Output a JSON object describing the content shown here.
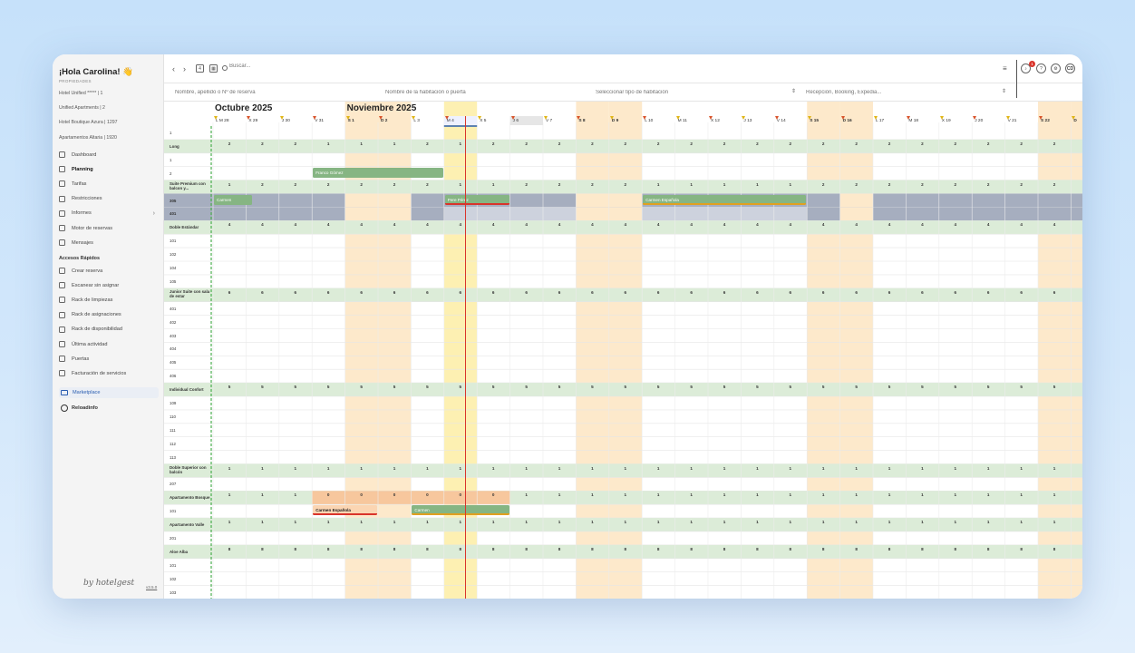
{
  "sidebar": {
    "greeting": "¡Hola Carolina! 👋",
    "properties_label": "PROPIEDADES",
    "properties": [
      "Hotel Unified ***** | 1",
      "Unified Apartments | 2",
      "Hotel Boutique Azura | 1297",
      "Apartamentos Altaria | 1920"
    ],
    "nav": [
      {
        "label": "Dashboard",
        "icon": "dashboard-icon"
      },
      {
        "label": "Planning",
        "icon": "calendar-icon",
        "active": true
      },
      {
        "label": "Tarifas",
        "icon": "rates-chart-icon"
      },
      {
        "label": "Restricciones",
        "icon": "restrictions-icon"
      },
      {
        "label": "Informes",
        "icon": "reports-icon",
        "chevron": true
      },
      {
        "label": "Motor de reservas",
        "icon": "booking-engine-icon"
      },
      {
        "label": "Mensajes",
        "icon": "messages-icon"
      }
    ],
    "quick_access_label": "Accesos Rápidos",
    "quick": [
      {
        "label": "Crear reserva",
        "icon": "plus-circle-icon"
      },
      {
        "label": "Escanear sin asignar",
        "icon": "scan-icon"
      },
      {
        "label": "Rack de limpiezas",
        "icon": "cleaning-icon"
      },
      {
        "label": "Rack de asignaciones",
        "icon": "assign-icon"
      },
      {
        "label": "Rack de disponibilidad",
        "icon": "availability-icon"
      },
      {
        "label": "Última actividad",
        "icon": "activity-icon"
      },
      {
        "label": "Puertas",
        "icon": "key-icon"
      },
      {
        "label": "Facturación de servicios",
        "icon": "invoice-icon"
      }
    ],
    "marketplace": "Marketplace",
    "reload": "Reloadinfo",
    "brand": "by hotelgest",
    "version": "v3.5.0"
  },
  "topbar": {
    "search_placeholder": "Buscar...",
    "initials": "CD",
    "notif_count": "1"
  },
  "filters": {
    "guest_placeholder": "Nombre, apellido o Nº de reserva",
    "room_placeholder": "Nombre de la habitación o puerta",
    "room_type_placeholder": "Seleccionar tipo de habitación",
    "channel_placeholder": "Recepción, Booking, Expedia..."
  },
  "calendar": {
    "months": [
      {
        "label": "Octubre 2025",
        "day_index": 0
      },
      {
        "label": "Noviembre 2025",
        "day_index": 4
      }
    ],
    "days": [
      "L M 28",
      "X 29",
      "J 30",
      "V 31",
      "S 1",
      "D 2",
      "L 3",
      "M 4",
      "X 5",
      "J 6",
      "V 7",
      "S 8",
      "D 9",
      "L 10",
      "M 11",
      "X 12",
      "J 13",
      "V 14",
      "S 15",
      "D 16",
      "L 17",
      "M 18",
      "X 19",
      "J 20",
      "V 21",
      "S 22",
      "D"
    ],
    "weekend_days": [
      4,
      5,
      11,
      12,
      18,
      19,
      25,
      26
    ],
    "today_index": 7,
    "rows": [
      {
        "type": "room",
        "label": "1"
      },
      {
        "type": "group",
        "label": "Long",
        "counts": [
          "2",
          "2",
          "2",
          "1",
          "1",
          "1",
          "2",
          "1",
          "2",
          "2",
          "2",
          "2",
          "2",
          "2",
          "2",
          "2",
          "2",
          "2",
          "2",
          "2",
          "2",
          "2",
          "2",
          "2",
          "2",
          "2",
          "2"
        ]
      },
      {
        "type": "room",
        "label": "1"
      },
      {
        "type": "room",
        "label": "2"
      },
      {
        "type": "group",
        "label": "Suite Premium con balcon y...",
        "counts": [
          "1",
          "2",
          "2",
          "2",
          "2",
          "2",
          "2",
          "1",
          "1",
          "2",
          "2",
          "2",
          "2",
          "1",
          "1",
          "1",
          "1",
          "1",
          "2",
          "2",
          "2",
          "2",
          "2",
          "2",
          "2",
          "2",
          "2"
        ]
      },
      {
        "type": "room",
        "label": "305",
        "blocked": true
      },
      {
        "type": "room",
        "label": "401",
        "blocked": true
      },
      {
        "type": "group",
        "label": "Doble Estándar",
        "counts": [
          "4",
          "4",
          "4",
          "4",
          "4",
          "4",
          "4",
          "4",
          "4",
          "4",
          "4",
          "4",
          "4",
          "4",
          "4",
          "4",
          "4",
          "4",
          "4",
          "4",
          "4",
          "4",
          "4",
          "4",
          "4",
          "4",
          "4"
        ]
      },
      {
        "type": "room",
        "label": "101"
      },
      {
        "type": "room",
        "label": "102"
      },
      {
        "type": "room",
        "label": "104"
      },
      {
        "type": "room",
        "label": "105"
      },
      {
        "type": "group",
        "label": "Junior Suite con sala de estar",
        "counts": [
          "6",
          "6",
          "6",
          "6",
          "6",
          "6",
          "6",
          "6",
          "6",
          "6",
          "6",
          "6",
          "6",
          "6",
          "6",
          "6",
          "6",
          "6",
          "6",
          "6",
          "6",
          "6",
          "6",
          "6",
          "6",
          "6",
          "6"
        ]
      },
      {
        "type": "room",
        "label": "401"
      },
      {
        "type": "room",
        "label": "402"
      },
      {
        "type": "room",
        "label": "403"
      },
      {
        "type": "room",
        "label": "404"
      },
      {
        "type": "room",
        "label": "405"
      },
      {
        "type": "room",
        "label": "406"
      },
      {
        "type": "group",
        "label": "Individual Confort",
        "counts": [
          "5",
          "5",
          "5",
          "5",
          "5",
          "5",
          "5",
          "5",
          "5",
          "5",
          "5",
          "5",
          "5",
          "5",
          "5",
          "5",
          "5",
          "5",
          "5",
          "5",
          "5",
          "5",
          "5",
          "5",
          "5",
          "5",
          "5"
        ]
      },
      {
        "type": "room",
        "label": "109"
      },
      {
        "type": "room",
        "label": "110"
      },
      {
        "type": "room",
        "label": "111"
      },
      {
        "type": "room",
        "label": "112"
      },
      {
        "type": "room",
        "label": "113"
      },
      {
        "type": "group",
        "label": "Doble Superior con balcón",
        "counts": [
          "1",
          "1",
          "1",
          "1",
          "1",
          "1",
          "1",
          "1",
          "1",
          "1",
          "1",
          "1",
          "1",
          "1",
          "1",
          "1",
          "1",
          "1",
          "1",
          "1",
          "1",
          "1",
          "1",
          "1",
          "1",
          "1",
          "1"
        ]
      },
      {
        "type": "room",
        "label": "207"
      },
      {
        "type": "group",
        "label": "Apartamento Bosque",
        "counts": [
          "1",
          "1",
          "1",
          "0",
          "0",
          "0",
          "0",
          "0",
          "0",
          "1",
          "1",
          "1",
          "1",
          "1",
          "1",
          "1",
          "1",
          "1",
          "1",
          "1",
          "1",
          "1",
          "1",
          "1",
          "1",
          "1",
          "1"
        ],
        "full": [
          3,
          4,
          5,
          6,
          7,
          8
        ]
      },
      {
        "type": "room",
        "label": "101"
      },
      {
        "type": "group",
        "label": "Apartamento Valle",
        "counts": [
          "1",
          "1",
          "1",
          "1",
          "1",
          "1",
          "1",
          "1",
          "1",
          "1",
          "1",
          "1",
          "1",
          "1",
          "1",
          "1",
          "1",
          "1",
          "1",
          "1",
          "1",
          "1",
          "1",
          "1",
          "1",
          "1",
          "1"
        ]
      },
      {
        "type": "room",
        "label": "201"
      },
      {
        "type": "group",
        "label": "Aloe Alba",
        "counts": [
          "8",
          "8",
          "8",
          "8",
          "8",
          "8",
          "8",
          "8",
          "8",
          "8",
          "8",
          "8",
          "8",
          "8",
          "8",
          "8",
          "8",
          "8",
          "8",
          "8",
          "8",
          "8",
          "8",
          "8",
          "8",
          "8",
          "8"
        ]
      },
      {
        "type": "room",
        "label": "101"
      },
      {
        "type": "room",
        "label": "102"
      },
      {
        "type": "room",
        "label": "103"
      }
    ],
    "reservations": [
      {
        "row": 3,
        "start": 3,
        "end": 7,
        "label": "Franco Gómez",
        "color": "#86b583",
        "underline": ""
      },
      {
        "row": 5,
        "start": 0,
        "end": 1.2,
        "label": "Carmen",
        "color": "#86b583",
        "underline": ""
      },
      {
        "row": 5,
        "start": 7,
        "end": 9,
        "label": "Pere Pérez",
        "color": "#86b583",
        "underline": "#d9342b"
      },
      {
        "row": 5,
        "start": 13,
        "end": 18,
        "label": "Carmen Española",
        "color": "#86b583",
        "underline": "#e0a020"
      },
      {
        "row": 28,
        "start": 3,
        "end": 5,
        "label": "Carmen Española",
        "color": "#fbd5b2",
        "underline": "#d9342b",
        "dark": true
      },
      {
        "row": 28,
        "start": 6,
        "end": 9,
        "label": "Carmen",
        "color": "#86b583",
        "underline": "#e0a020"
      }
    ]
  },
  "colors": {
    "group_row": "#dcecd8",
    "weekend": "#fde9cb",
    "today": "#fdf0b2",
    "blocked": "#a6aebf",
    "blocked_light": "#cdd2dd",
    "full": "#f7c79d",
    "today_line": "#d9342b"
  }
}
